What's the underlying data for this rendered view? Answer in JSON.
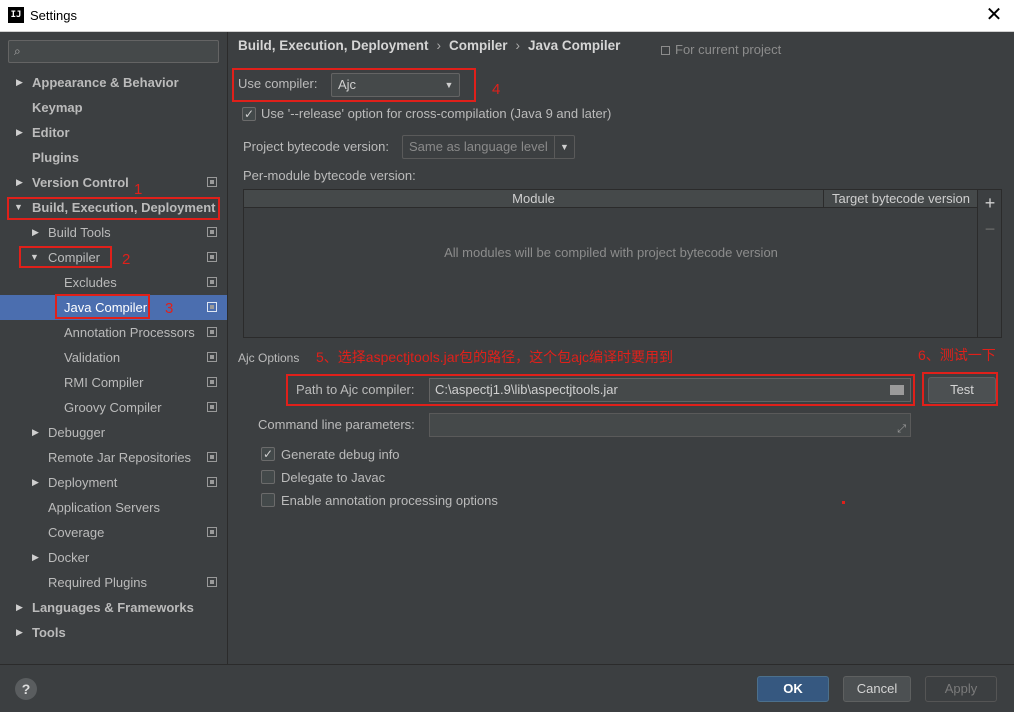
{
  "window": {
    "title": "Settings",
    "app_icon": "IJ"
  },
  "search": {
    "placeholder": ""
  },
  "sidebar": {
    "items": [
      {
        "label": "Appearance & Behavior"
      },
      {
        "label": "Keymap"
      },
      {
        "label": "Editor"
      },
      {
        "label": "Plugins"
      },
      {
        "label": "Version Control"
      },
      {
        "label": "Build, Execution, Deployment"
      },
      {
        "label": "Build Tools"
      },
      {
        "label": "Compiler"
      },
      {
        "label": "Excludes"
      },
      {
        "label": "Java Compiler"
      },
      {
        "label": "Annotation Processors"
      },
      {
        "label": "Validation"
      },
      {
        "label": "RMI Compiler"
      },
      {
        "label": "Groovy Compiler"
      },
      {
        "label": "Debugger"
      },
      {
        "label": "Remote Jar Repositories"
      },
      {
        "label": "Deployment"
      },
      {
        "label": "Application Servers"
      },
      {
        "label": "Coverage"
      },
      {
        "label": "Docker"
      },
      {
        "label": "Required Plugins"
      },
      {
        "label": "Languages & Frameworks"
      },
      {
        "label": "Tools"
      }
    ]
  },
  "breadcrumb": {
    "part1": "Build, Execution, Deployment",
    "part2": "Compiler",
    "part3": "Java Compiler",
    "separator": "›"
  },
  "for_project": "For current project",
  "compiler": {
    "use_compiler_label": "Use compiler:",
    "use_compiler_value": "Ajc",
    "release_option_label": "Use '--release' option for cross-compilation (Java 9 and later)",
    "release_option_checked": true,
    "bytecode_label": "Project bytecode version:",
    "bytecode_value": "Same as language level",
    "per_module_label": "Per-module bytecode version:",
    "table": {
      "columns": [
        "Module",
        "Target bytecode version"
      ],
      "empty_text": "All modules will be compiled with project bytecode version",
      "add_symbol": "+",
      "remove_symbol": "−"
    }
  },
  "ajc": {
    "section_label": "Ajc Options",
    "path_label": "Path to Ajc compiler:",
    "path_value": "C:\\aspectj1.9\\lib\\aspectjtools.jar",
    "test_button": "Test",
    "cmd_label": "Command line parameters:",
    "cmd_value": "",
    "generate_debug_label": "Generate debug info",
    "generate_debug_checked": true,
    "delegate_javac_label": "Delegate to Javac",
    "delegate_javac_checked": false,
    "annotation_processing_label": "Enable annotation processing options",
    "annotation_processing_checked": false
  },
  "footer": {
    "help": "?",
    "ok": "OK",
    "cancel": "Cancel",
    "apply": "Apply"
  },
  "annotations": {
    "n1": "1",
    "n2": "2",
    "n3": "3",
    "n4": "4",
    "note5": "5、选择aspectjtools.jar包的路径，这个包ajc编译时要用到",
    "note6": "6、测试一下"
  },
  "colors": {
    "accent_selection": "#4b6eaf",
    "annotation_red": "#e0201a",
    "ok_button": "#365880",
    "background": "#3c3f41"
  },
  "icons": [
    "search-icon",
    "close-icon",
    "project-scope-icon",
    "folder-icon",
    "expand-icon",
    "help-icon",
    "dropdown-arrow-icon",
    "tree-arrow-icon"
  ]
}
